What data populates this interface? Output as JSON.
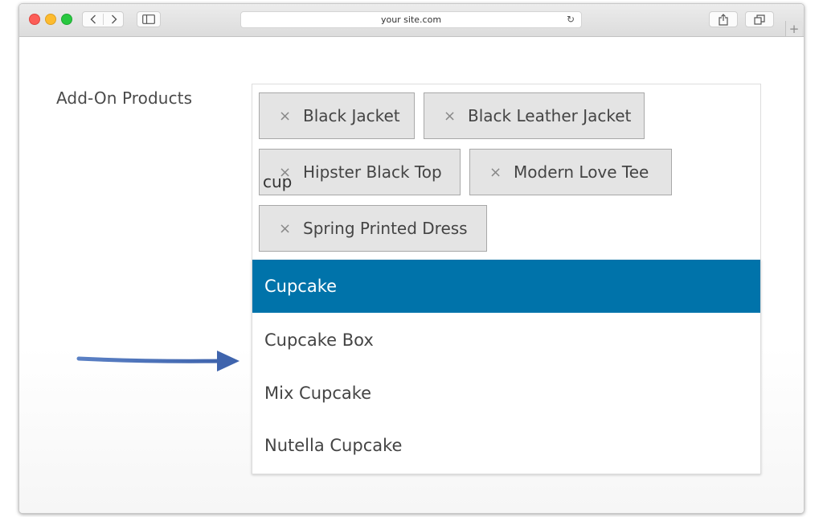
{
  "browser": {
    "address": "your site.com",
    "colors": {
      "close": "#fc5d57",
      "minimize": "#fdbb2e",
      "zoom": "#28c840"
    },
    "icons": {
      "back": "chevron-left-icon",
      "forward": "chevron-right-icon",
      "sidebar": "sidebar-icon",
      "reload": "reload-icon",
      "share": "share-icon",
      "tabs": "tabs-icon",
      "new_tab": "plus-icon"
    },
    "reload_glyph": "↻",
    "new_tab_glyph": "+"
  },
  "form": {
    "label": "Add-On Products",
    "remove_glyph": "×",
    "selected": [
      {
        "label": "Black Jacket"
      },
      {
        "label": "Black Leather Jacket"
      },
      {
        "label": "Hipster Black Top"
      },
      {
        "label": "Modern Love Tee"
      },
      {
        "label": "Spring Printed Dress"
      }
    ],
    "search_value": "cup",
    "options": [
      {
        "label": "Cupcake",
        "highlighted": true
      },
      {
        "label": "Cupcake Box",
        "highlighted": false
      },
      {
        "label": "Mix Cupcake",
        "highlighted": false
      },
      {
        "label": "Nutella Cupcake",
        "highlighted": false
      }
    ],
    "highlight_color": "#0073aa",
    "annotation_arrow_color": "#4a72b8"
  }
}
